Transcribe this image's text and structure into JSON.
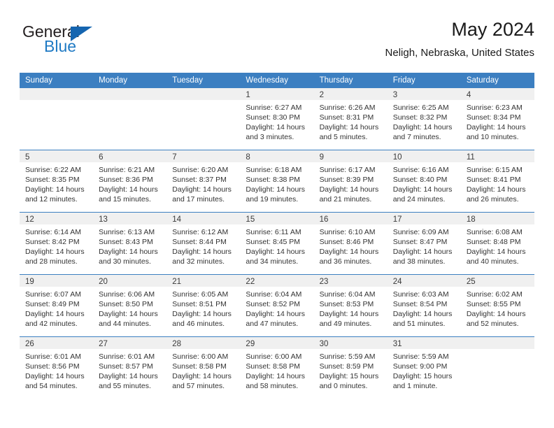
{
  "brand": {
    "name_top": "General",
    "name_bottom": "Blue",
    "accent_color": "#1565b0",
    "text_color": "#231f20"
  },
  "header": {
    "title": "May 2024",
    "subtitle": "Neligh, Nebraska, United States"
  },
  "calendar": {
    "header_bg": "#3c7fc1",
    "daynum_bg": "#f0f0f0",
    "weekdays": [
      "Sunday",
      "Monday",
      "Tuesday",
      "Wednesday",
      "Thursday",
      "Friday",
      "Saturday"
    ],
    "weeks": [
      [
        {
          "day": "",
          "sunrise": "",
          "sunset": "",
          "daylight_line1": "",
          "daylight_line2": ""
        },
        {
          "day": "",
          "sunrise": "",
          "sunset": "",
          "daylight_line1": "",
          "daylight_line2": ""
        },
        {
          "day": "",
          "sunrise": "",
          "sunset": "",
          "daylight_line1": "",
          "daylight_line2": ""
        },
        {
          "day": "1",
          "sunrise": "Sunrise: 6:27 AM",
          "sunset": "Sunset: 8:30 PM",
          "daylight_line1": "Daylight: 14 hours",
          "daylight_line2": "and 3 minutes."
        },
        {
          "day": "2",
          "sunrise": "Sunrise: 6:26 AM",
          "sunset": "Sunset: 8:31 PM",
          "daylight_line1": "Daylight: 14 hours",
          "daylight_line2": "and 5 minutes."
        },
        {
          "day": "3",
          "sunrise": "Sunrise: 6:25 AM",
          "sunset": "Sunset: 8:32 PM",
          "daylight_line1": "Daylight: 14 hours",
          "daylight_line2": "and 7 minutes."
        },
        {
          "day": "4",
          "sunrise": "Sunrise: 6:23 AM",
          "sunset": "Sunset: 8:34 PM",
          "daylight_line1": "Daylight: 14 hours",
          "daylight_line2": "and 10 minutes."
        }
      ],
      [
        {
          "day": "5",
          "sunrise": "Sunrise: 6:22 AM",
          "sunset": "Sunset: 8:35 PM",
          "daylight_line1": "Daylight: 14 hours",
          "daylight_line2": "and 12 minutes."
        },
        {
          "day": "6",
          "sunrise": "Sunrise: 6:21 AM",
          "sunset": "Sunset: 8:36 PM",
          "daylight_line1": "Daylight: 14 hours",
          "daylight_line2": "and 15 minutes."
        },
        {
          "day": "7",
          "sunrise": "Sunrise: 6:20 AM",
          "sunset": "Sunset: 8:37 PM",
          "daylight_line1": "Daylight: 14 hours",
          "daylight_line2": "and 17 minutes."
        },
        {
          "day": "8",
          "sunrise": "Sunrise: 6:18 AM",
          "sunset": "Sunset: 8:38 PM",
          "daylight_line1": "Daylight: 14 hours",
          "daylight_line2": "and 19 minutes."
        },
        {
          "day": "9",
          "sunrise": "Sunrise: 6:17 AM",
          "sunset": "Sunset: 8:39 PM",
          "daylight_line1": "Daylight: 14 hours",
          "daylight_line2": "and 21 minutes."
        },
        {
          "day": "10",
          "sunrise": "Sunrise: 6:16 AM",
          "sunset": "Sunset: 8:40 PM",
          "daylight_line1": "Daylight: 14 hours",
          "daylight_line2": "and 24 minutes."
        },
        {
          "day": "11",
          "sunrise": "Sunrise: 6:15 AM",
          "sunset": "Sunset: 8:41 PM",
          "daylight_line1": "Daylight: 14 hours",
          "daylight_line2": "and 26 minutes."
        }
      ],
      [
        {
          "day": "12",
          "sunrise": "Sunrise: 6:14 AM",
          "sunset": "Sunset: 8:42 PM",
          "daylight_line1": "Daylight: 14 hours",
          "daylight_line2": "and 28 minutes."
        },
        {
          "day": "13",
          "sunrise": "Sunrise: 6:13 AM",
          "sunset": "Sunset: 8:43 PM",
          "daylight_line1": "Daylight: 14 hours",
          "daylight_line2": "and 30 minutes."
        },
        {
          "day": "14",
          "sunrise": "Sunrise: 6:12 AM",
          "sunset": "Sunset: 8:44 PM",
          "daylight_line1": "Daylight: 14 hours",
          "daylight_line2": "and 32 minutes."
        },
        {
          "day": "15",
          "sunrise": "Sunrise: 6:11 AM",
          "sunset": "Sunset: 8:45 PM",
          "daylight_line1": "Daylight: 14 hours",
          "daylight_line2": "and 34 minutes."
        },
        {
          "day": "16",
          "sunrise": "Sunrise: 6:10 AM",
          "sunset": "Sunset: 8:46 PM",
          "daylight_line1": "Daylight: 14 hours",
          "daylight_line2": "and 36 minutes."
        },
        {
          "day": "17",
          "sunrise": "Sunrise: 6:09 AM",
          "sunset": "Sunset: 8:47 PM",
          "daylight_line1": "Daylight: 14 hours",
          "daylight_line2": "and 38 minutes."
        },
        {
          "day": "18",
          "sunrise": "Sunrise: 6:08 AM",
          "sunset": "Sunset: 8:48 PM",
          "daylight_line1": "Daylight: 14 hours",
          "daylight_line2": "and 40 minutes."
        }
      ],
      [
        {
          "day": "19",
          "sunrise": "Sunrise: 6:07 AM",
          "sunset": "Sunset: 8:49 PM",
          "daylight_line1": "Daylight: 14 hours",
          "daylight_line2": "and 42 minutes."
        },
        {
          "day": "20",
          "sunrise": "Sunrise: 6:06 AM",
          "sunset": "Sunset: 8:50 PM",
          "daylight_line1": "Daylight: 14 hours",
          "daylight_line2": "and 44 minutes."
        },
        {
          "day": "21",
          "sunrise": "Sunrise: 6:05 AM",
          "sunset": "Sunset: 8:51 PM",
          "daylight_line1": "Daylight: 14 hours",
          "daylight_line2": "and 46 minutes."
        },
        {
          "day": "22",
          "sunrise": "Sunrise: 6:04 AM",
          "sunset": "Sunset: 8:52 PM",
          "daylight_line1": "Daylight: 14 hours",
          "daylight_line2": "and 47 minutes."
        },
        {
          "day": "23",
          "sunrise": "Sunrise: 6:04 AM",
          "sunset": "Sunset: 8:53 PM",
          "daylight_line1": "Daylight: 14 hours",
          "daylight_line2": "and 49 minutes."
        },
        {
          "day": "24",
          "sunrise": "Sunrise: 6:03 AM",
          "sunset": "Sunset: 8:54 PM",
          "daylight_line1": "Daylight: 14 hours",
          "daylight_line2": "and 51 minutes."
        },
        {
          "day": "25",
          "sunrise": "Sunrise: 6:02 AM",
          "sunset": "Sunset: 8:55 PM",
          "daylight_line1": "Daylight: 14 hours",
          "daylight_line2": "and 52 minutes."
        }
      ],
      [
        {
          "day": "26",
          "sunrise": "Sunrise: 6:01 AM",
          "sunset": "Sunset: 8:56 PM",
          "daylight_line1": "Daylight: 14 hours",
          "daylight_line2": "and 54 minutes."
        },
        {
          "day": "27",
          "sunrise": "Sunrise: 6:01 AM",
          "sunset": "Sunset: 8:57 PM",
          "daylight_line1": "Daylight: 14 hours",
          "daylight_line2": "and 55 minutes."
        },
        {
          "day": "28",
          "sunrise": "Sunrise: 6:00 AM",
          "sunset": "Sunset: 8:58 PM",
          "daylight_line1": "Daylight: 14 hours",
          "daylight_line2": "and 57 minutes."
        },
        {
          "day": "29",
          "sunrise": "Sunrise: 6:00 AM",
          "sunset": "Sunset: 8:58 PM",
          "daylight_line1": "Daylight: 14 hours",
          "daylight_line2": "and 58 minutes."
        },
        {
          "day": "30",
          "sunrise": "Sunrise: 5:59 AM",
          "sunset": "Sunset: 8:59 PM",
          "daylight_line1": "Daylight: 15 hours",
          "daylight_line2": "and 0 minutes."
        },
        {
          "day": "31",
          "sunrise": "Sunrise: 5:59 AM",
          "sunset": "Sunset: 9:00 PM",
          "daylight_line1": "Daylight: 15 hours",
          "daylight_line2": "and 1 minute."
        }
      ]
    ]
  }
}
